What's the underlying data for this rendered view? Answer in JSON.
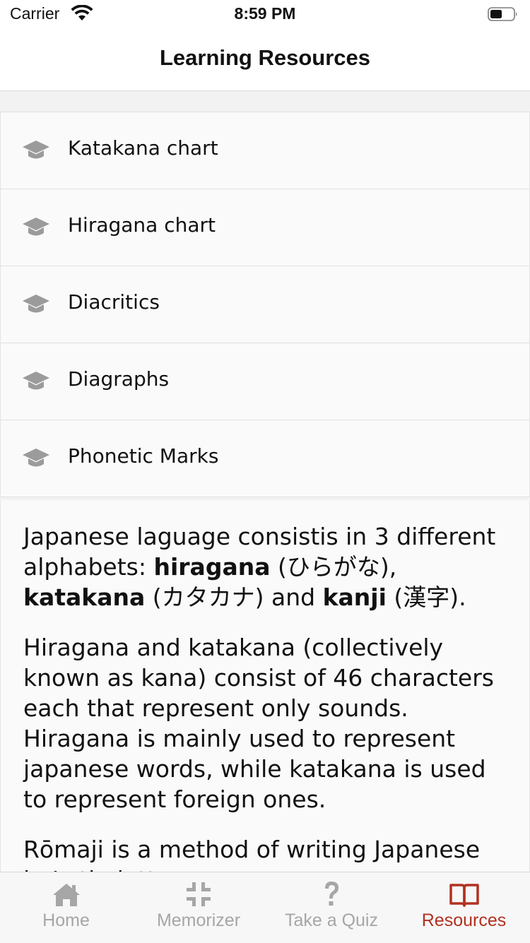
{
  "status_bar": {
    "carrier": "Carrier",
    "time": "8:59 PM"
  },
  "nav": {
    "title": "Learning Resources"
  },
  "resources": {
    "items": [
      {
        "label": "Katakana chart",
        "icon": "graduation-cap-icon"
      },
      {
        "label": "Hiragana chart",
        "icon": "graduation-cap-icon"
      },
      {
        "label": "Diacritics",
        "icon": "graduation-cap-icon"
      },
      {
        "label": "Diagraphs",
        "icon": "graduation-cap-icon"
      },
      {
        "label": "Phonetic Marks",
        "icon": "graduation-cap-icon"
      }
    ]
  },
  "article": {
    "p1": {
      "t1": "Japanese laguage consistis in 3 different alphabets: ",
      "b1": "hiragana",
      "t2": " (ひらがな), ",
      "b2": "katakana",
      "t3": " (カタカナ) and ",
      "b3": "kanji",
      "t4": " (漢字)."
    },
    "p2": "Hiragana and katakana (collectively known as kana) consist of 46 characters each that represent only sounds. Hiragana is mainly used to represent japanese words, while katakana is used to represent foreign ones.",
    "p3": "Rōmaji is a method of writing Japanese in Latin letters."
  },
  "tabs": [
    {
      "label": "Home",
      "icon": "home-icon",
      "active": false
    },
    {
      "label": "Memorizer",
      "icon": "compress-icon",
      "active": false
    },
    {
      "label": "Take a Quiz",
      "icon": "question-mark-icon",
      "active": false
    },
    {
      "label": "Resources",
      "icon": "open-book-icon",
      "active": true
    }
  ],
  "colors": {
    "accent": "#b23121",
    "inactive": "#a6a6a6",
    "icon_gray": "#9b9b9b"
  }
}
